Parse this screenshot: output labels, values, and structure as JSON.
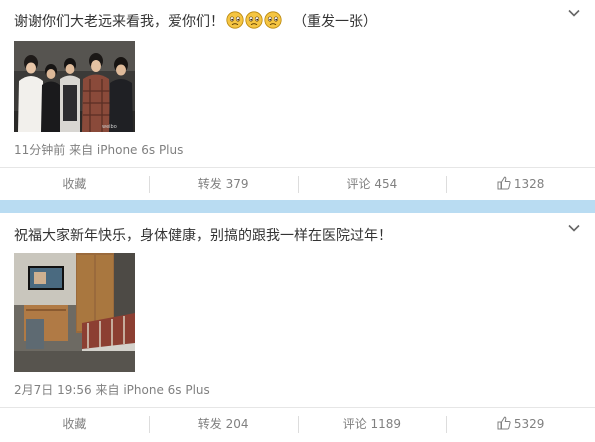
{
  "posts": [
    {
      "text": "谢谢你们大老远来看我，爱你们！",
      "emoji_icons": [
        "sad-face-icon",
        "sad-face-icon",
        "sad-face-icon"
      ],
      "suffix": "（重发一张）",
      "time": "11分钟前",
      "source": "来自 iPhone 6s Plus",
      "actions": {
        "favorite": "收藏",
        "repost": "转发 379",
        "comment": "评论 454",
        "like": "1328"
      }
    },
    {
      "text": "祝福大家新年快乐，身体健康，别搞的跟我一样在医院过年！",
      "time": "2月7日 19:56",
      "source": "来自 iPhone 6s Plus",
      "actions": {
        "favorite": "收藏",
        "repost": "转发 204",
        "comment": "评论 1189",
        "like": "5329"
      }
    }
  ],
  "colors": {
    "divider": "#b9dcf2",
    "meta_text": "#808080",
    "body_text": "#333333",
    "emoji": "#f5c542"
  }
}
